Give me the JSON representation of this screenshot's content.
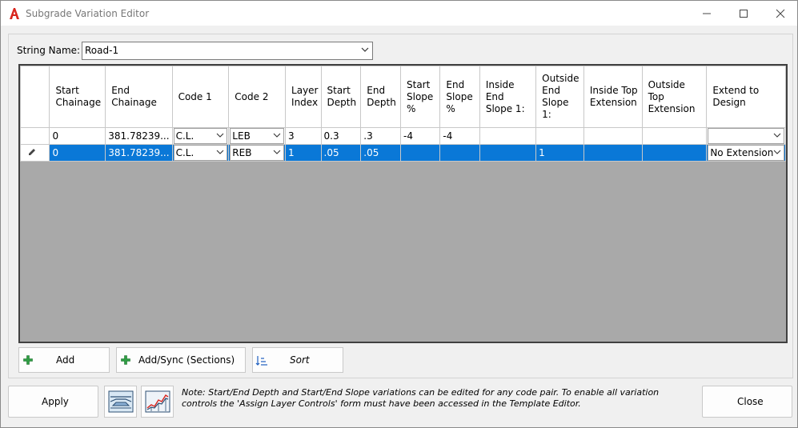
{
  "window": {
    "title": "Subgrade Variation Editor"
  },
  "string_name": {
    "label": "String Name:",
    "value": "Road-1"
  },
  "grid": {
    "columns": [
      "",
      "Start Chainage",
      "End Chainage",
      "Code 1",
      "Code 2",
      "Layer Index",
      "Start Depth",
      "End Depth",
      "Start Slope %",
      "End Slope %",
      "Inside End Slope 1:",
      "Outside End Slope 1:",
      "Inside Top Extension",
      "Outside Top Extension",
      "Extend to Design"
    ],
    "rows": [
      {
        "start_chainage": "0",
        "end_chainage": "381.78239...",
        "code1": "C.L.",
        "code2": "LEB",
        "layer_index": "3",
        "start_depth": "0.3",
        "end_depth": ".3",
        "start_slope": "-4",
        "end_slope": "-4",
        "inside_end_slope": "",
        "outside_end_slope": "",
        "inside_top_ext": "",
        "outside_top_ext": "",
        "extend_to_design": ""
      },
      {
        "start_chainage": "0",
        "end_chainage": "381.78239...",
        "code1": "C.L.",
        "code2": "REB",
        "layer_index": "1",
        "start_depth": ".05",
        "end_depth": ".05",
        "start_slope": "",
        "end_slope": "",
        "inside_end_slope": "",
        "outside_end_slope": "1",
        "inside_top_ext": "",
        "outside_top_ext": "",
        "extend_to_design": "No Extension"
      }
    ]
  },
  "buttons": {
    "add": "Add",
    "add_sync": "Add/Sync (Sections)",
    "sort": "Sort",
    "apply": "Apply",
    "close": "Close"
  },
  "note": "Note: Start/End Depth and Start/End Slope variations can be edited for any code pair. To enable all variation controls the 'Assign Layer Controls' form must have been accessed in the Template Editor.",
  "colors": {
    "selection": "#0a78d7",
    "grid_background": "#a9a9a9",
    "app_icon": "#d9251d",
    "add_icon": "#2f9e44"
  }
}
